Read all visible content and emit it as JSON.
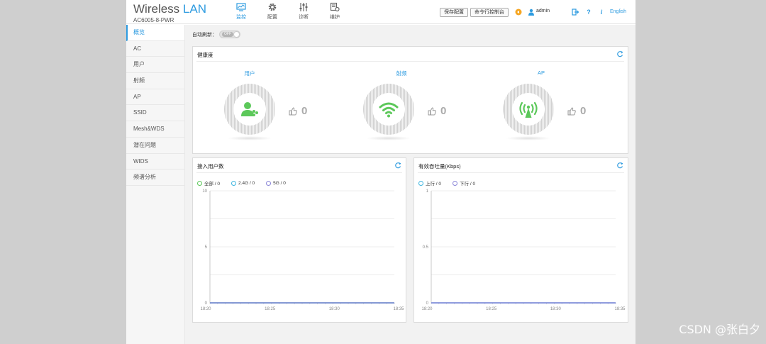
{
  "brand": {
    "title_main": "Wireless",
    "title_accent": "LAN",
    "model": "AC6005-8-PWR"
  },
  "nav": [
    {
      "label": "监控",
      "icon": "monitor-icon",
      "active": true
    },
    {
      "label": "配置",
      "icon": "gear-icon",
      "active": false
    },
    {
      "label": "诊断",
      "icon": "sliders-icon",
      "active": false
    },
    {
      "label": "维护",
      "icon": "maintenance-icon",
      "active": false
    }
  ],
  "header": {
    "save_label": "保存配置",
    "console_label": "命令行控制台",
    "user": "admin",
    "language": "English",
    "help_glyph": "?",
    "info_glyph": "i"
  },
  "sidebar": {
    "items": [
      {
        "label": "概览",
        "active": true
      },
      {
        "label": "AC"
      },
      {
        "label": "用户"
      },
      {
        "label": "射频"
      },
      {
        "label": "AP"
      },
      {
        "label": "SSID"
      },
      {
        "label": "Mesh&WDS"
      },
      {
        "label": "潜在问题"
      },
      {
        "label": "WIDS"
      },
      {
        "label": "频谱分析"
      }
    ]
  },
  "auto_refresh": {
    "label": "自动刷新：",
    "state": "OFF"
  },
  "health": {
    "title": "健康度",
    "items": [
      {
        "label": "用户",
        "icon": "users-icon",
        "score": "0"
      },
      {
        "label": "射频",
        "icon": "wifi-icon",
        "score": "0"
      },
      {
        "label": "AP",
        "icon": "antenna-icon",
        "score": "0"
      }
    ],
    "accent_color": "#5cc85a"
  },
  "users_panel": {
    "title": "接入用户数",
    "legend": [
      {
        "label": "全部 / 0",
        "color": "#5cc85a"
      },
      {
        "label": "2.4G / 0",
        "color": "#3fb6e0"
      },
      {
        "label": "5G / 0",
        "color": "#8a86d8"
      }
    ]
  },
  "throughput_panel": {
    "title": "有效吞吐量(Kbps)",
    "legend": [
      {
        "label": "上行 / 0",
        "color": "#3fb6e0"
      },
      {
        "label": "下行 / 0",
        "color": "#8a86d8"
      }
    ]
  },
  "chart_data": [
    {
      "type": "line",
      "title": "接入用户数",
      "x": [
        "18:20",
        "18:25",
        "18:30",
        "18:35"
      ],
      "yticks": [
        "0",
        "5",
        "10"
      ],
      "ylim": [
        0,
        10
      ],
      "series": [
        {
          "name": "全部",
          "values": [
            0,
            0,
            0,
            0
          ]
        },
        {
          "name": "2.4G",
          "values": [
            0,
            0,
            0,
            0
          ]
        },
        {
          "name": "5G",
          "values": [
            0,
            0,
            0,
            0
          ]
        }
      ],
      "grid": true
    },
    {
      "type": "line",
      "title": "有效吞吐量(Kbps)",
      "x": [
        "18:20",
        "18:25",
        "18:30",
        "18:35"
      ],
      "yticks": [
        "0",
        "0.5",
        "1"
      ],
      "ylim": [
        0,
        1
      ],
      "series": [
        {
          "name": "上行",
          "values": [
            0,
            0,
            0,
            0
          ]
        },
        {
          "name": "下行",
          "values": [
            0,
            0,
            0,
            0
          ]
        }
      ],
      "grid": true
    }
  ],
  "watermark": "CSDN @张白夕"
}
